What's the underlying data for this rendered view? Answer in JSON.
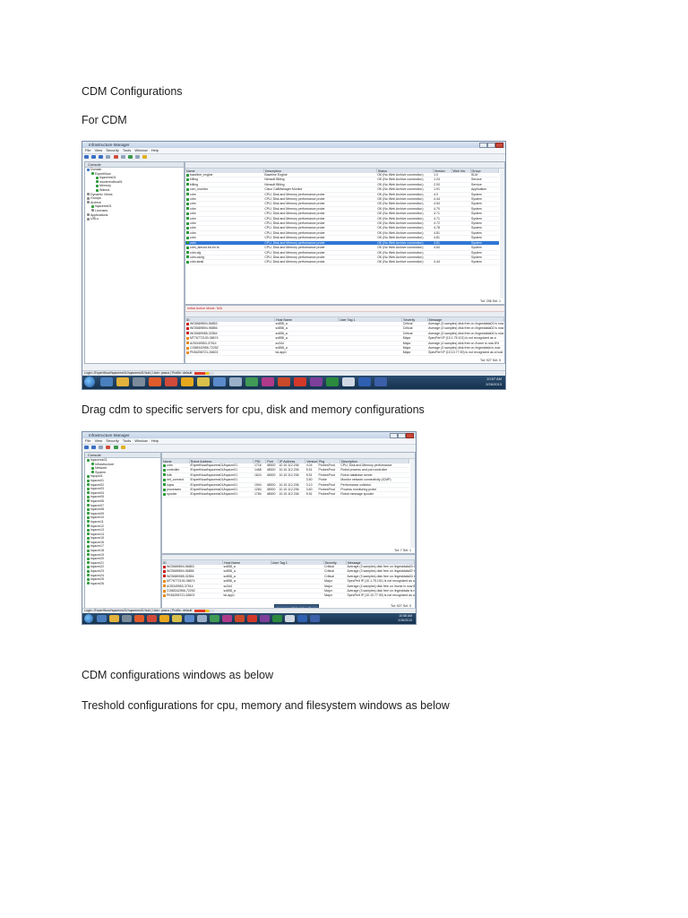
{
  "doc": {
    "heading1": "CDM Configurations",
    "heading2": "For CDM",
    "caption_drag": "Drag cdm to specific servers for cpu, disk and memory configurations",
    "caption_windows": "CDM configurations windows as below",
    "caption_threshold": "Treshold configurations for cpu, memory and filesystem windows as below"
  },
  "shot1": {
    "title": "Infrastructure Manager",
    "menu": [
      "File",
      "View",
      "Security",
      "Tools",
      "Window",
      "Help"
    ],
    "tree_header": "Console",
    "tree": [
      {
        "label": "Domain",
        "indent": 0,
        "color": "#3a74c8"
      },
      {
        "label": "ExpertNow",
        "indent": 1,
        "color": "#2e9a3a"
      },
      {
        "label": "hqacems01",
        "indent": 2,
        "color": "#2e9a3a"
      },
      {
        "label": "msoterrxdbxa01",
        "indent": 2,
        "color": "#2e9a3a"
      },
      {
        "label": "Memory",
        "indent": 2,
        "color": "#2e9a3a"
      },
      {
        "label": "Wanna",
        "indent": 2,
        "color": "#2e9a3a"
      },
      {
        "label": "Dynamic Views",
        "indent": 0,
        "color": "#8a8a8a"
      },
      {
        "label": "Groups",
        "indent": 0,
        "color": "#8a8a8a"
      },
      {
        "label": "Archive",
        "indent": 0,
        "color": "#8a8a8a"
      },
      {
        "label": "hqacems01",
        "indent": 1,
        "color": "#2e9a3a"
      },
      {
        "label": "Licenses",
        "indent": 1,
        "color": "#8a8a8a"
      },
      {
        "label": "Applications",
        "indent": 0,
        "color": "#8a8a8a"
      },
      {
        "label": "URLs",
        "indent": 0,
        "color": "#8a8a8a"
      }
    ],
    "probe_columns": [
      "Name",
      "Description",
      "Status",
      "Version",
      "Web Ver.",
      "Group"
    ],
    "probes": [
      {
        "name": "baseline_engine",
        "desc": "Baseline Engine",
        "status": "OK (No Web Archive connection)",
        "version": "1.0",
        "web": "",
        "group": "SLM"
      },
      {
        "name": "billing",
        "desc": "Nimsoft Billing",
        "status": "OK (No Web Archive connection)",
        "version": "1.24",
        "web": "",
        "group": "Service"
      },
      {
        "name": "billing",
        "desc": "Nimsoft Billing",
        "status": "OK (No Web Archive connection)",
        "version": "2.00",
        "web": "",
        "group": "Service"
      },
      {
        "name": "ccm_monitor",
        "desc": "Cisco CallManager Monitor",
        "status": "OK (No Web Archive connection)",
        "version": "1.91",
        "web": "",
        "group": "Application"
      },
      {
        "name": "cdm",
        "desc": "CPU, Disk and Memory performance probe",
        "status": "OK (No Web Archive connection)",
        "version": "4.0",
        "web": "",
        "group": "System"
      },
      {
        "name": "cdm",
        "desc": "CPU, Disk and Memory performance probe",
        "status": "OK (No Web Archive connection)",
        "version": "4.44",
        "web": "",
        "group": "System"
      },
      {
        "name": "cdm",
        "desc": "CPU, Disk and Memory performance probe",
        "status": "OK (No Web Archive connection)",
        "version": "4.54",
        "web": "",
        "group": "System"
      },
      {
        "name": "cdm",
        "desc": "CPU, Disk and Memory performance probe",
        "status": "OK (No Web Archive connection)",
        "version": "4.70",
        "web": "",
        "group": "System"
      },
      {
        "name": "cdm",
        "desc": "CPU, Disk and Memory performance probe",
        "status": "OK (No Web Archive connection)",
        "version": "4.71",
        "web": "",
        "group": "System"
      },
      {
        "name": "cdm",
        "desc": "CPU, Disk and Memory performance probe",
        "status": "OK (No Web Archive connection)",
        "version": "4.71",
        "web": "",
        "group": "System"
      },
      {
        "name": "cdm",
        "desc": "CPU, Disk and Memory performance probe",
        "status": "OK (No Web Archive connection)",
        "version": "4.72",
        "web": "",
        "group": "System"
      },
      {
        "name": "cdm",
        "desc": "CPU, Disk and Memory performance probe",
        "status": "OK (No Web Archive connection)",
        "version": "4.78",
        "web": "",
        "group": "System"
      },
      {
        "name": "cdm",
        "desc": "CPU, Disk and Memory performance probe",
        "status": "OK (No Web Archive connection)",
        "version": "4.81",
        "web": "",
        "group": "System"
      },
      {
        "name": "cdm",
        "desc": "CPU, Disk and Memory performance probe",
        "status": "OK (No Web Archive connection)",
        "version": "4.81",
        "web": "",
        "group": "System"
      },
      {
        "name": "cdm",
        "desc": "CPU, Disk and Memory performance probe",
        "status": "OK (No Web Archive connection)",
        "version": "4.81",
        "web": "",
        "group": "System"
      },
      {
        "name": "cdm_almost.trd.en.fo",
        "desc": "CPU, Disk and Memory performance probe",
        "status": "OK (No Web Archive connection)",
        "version": "4.84",
        "web": "",
        "group": "System"
      },
      {
        "name": "cdm.cfg",
        "desc": "CPU, Disk and Memory performance probe",
        "status": "OK (No Web Archive connection)",
        "version": "",
        "web": "",
        "group": "System"
      },
      {
        "name": "cdm.cdcfg",
        "desc": "CPU, Disk and Memory performance probe",
        "status": "OK (No Web Archive connection)",
        "version": "",
        "web": "",
        "group": "System"
      },
      {
        "name": "cdm.strait",
        "desc": "CPU, Disk and Memory performance probe",
        "status": "OK (No Web Archive connection)",
        "version": "4.44",
        "web": "",
        "group": "System"
      }
    ],
    "probe_total": "Tot: 296  Sel: 1",
    "alarm_title": "Initial Active Mode: N/A",
    "alarm_columns": [
      "ID",
      "Host Name",
      "User Tag 1",
      "Severity",
      "Message"
    ],
    "alarms": [
      {
        "id": "WO5689894-56853",
        "host": "sx858_a",
        "sev": "Critical",
        "msg": "Average (3 samples) disk free on /ingestdata03 is now"
      },
      {
        "id": "WO5689894-96856",
        "host": "sx858_a",
        "sev": "Critical",
        "msg": "Average (3 samples) disk free on /ingestdata02 is now"
      },
      {
        "id": "WO5689985-32554",
        "host": "sx858_a",
        "sev": "Critical",
        "msg": "Average (3 samples) disk free on /ingestdata04 is now"
      },
      {
        "id": "MT76772100-36674",
        "host": "sx858_a",
        "sev": "Major",
        "msg": "SpecPerf IP (10.1.75.101) is not recognized as a"
      },
      {
        "id": "AO5349553-37514",
        "host": "sx344",
        "sev": "Major",
        "msg": "Average (4 samples) disk free on /home is now 8%"
      },
      {
        "id": "CO88342556-72252",
        "host": "sx858_a",
        "sev": "Major",
        "msg": "Average (3 samples) disk free on /ingestdata is now"
      },
      {
        "id": "PK84256721-26603",
        "host": "tsl-app1",
        "sev": "Major",
        "msg": "SpecPerf IP (10.10.77.90) is not recognized as a host"
      }
    ],
    "alarm_total": "Tot: 927  Sel: 0",
    "statusbar": "Login: /ExpertNow/hqacems01/hqacems01/hub | User: pasus | Profile: default",
    "clock_time": "10:57 AM",
    "clock_date": "2/26/2013"
  },
  "shot2": {
    "title": "Infrastructure Manager",
    "menu": [
      "File",
      "View",
      "Security",
      "Tools",
      "Window",
      "Help"
    ],
    "tree_header": "Console",
    "tree": [
      {
        "label": "hqacems01",
        "indent": 0,
        "color": "#2e9a3a"
      },
      {
        "label": "Infrastructure",
        "indent": 1,
        "color": "#2e9a3a"
      },
      {
        "label": "Network",
        "indent": 1,
        "color": "#2e9a3a"
      },
      {
        "label": "System",
        "indent": 1,
        "color": "#2e9a3a"
      },
      {
        "label": "hqcpo01",
        "indent": 0,
        "color": "#2e9a3a"
      },
      {
        "label": "hqacrn01",
        "indent": 0,
        "color": "#2e9a3a"
      },
      {
        "label": "hqacrn02",
        "indent": 0,
        "color": "#2e9a3a"
      },
      {
        "label": "hqacrn03",
        "indent": 0,
        "color": "#2e9a3a"
      },
      {
        "label": "hqacrn04",
        "indent": 0,
        "color": "#2e9a3a"
      },
      {
        "label": "hqacrn05",
        "indent": 0,
        "color": "#2e9a3a"
      },
      {
        "label": "hqacrn06",
        "indent": 0,
        "color": "#2e9a3a"
      },
      {
        "label": "hqacrn07",
        "indent": 0,
        "color": "#2e9a3a"
      },
      {
        "label": "hqacrn08",
        "indent": 0,
        "color": "#2e9a3a"
      },
      {
        "label": "hqacrn09",
        "indent": 0,
        "color": "#2e9a3a"
      },
      {
        "label": "hqacrn10",
        "indent": 0,
        "color": "#2e9a3a"
      },
      {
        "label": "hqacrn11",
        "indent": 0,
        "color": "#2e9a3a"
      },
      {
        "label": "hqacrn12",
        "indent": 0,
        "color": "#2e9a3a"
      },
      {
        "label": "hqacrn13",
        "indent": 0,
        "color": "#2e9a3a"
      },
      {
        "label": "hqacrn14",
        "indent": 0,
        "color": "#2e9a3a"
      },
      {
        "label": "hqacrn15",
        "indent": 0,
        "color": "#2e9a3a"
      },
      {
        "label": "hqacrn16",
        "indent": 0,
        "color": "#2e9a3a"
      },
      {
        "label": "hqacrn17",
        "indent": 0,
        "color": "#2e9a3a"
      },
      {
        "label": "hqacrn18",
        "indent": 0,
        "color": "#2e9a3a"
      },
      {
        "label": "hqacrn19",
        "indent": 0,
        "color": "#2e9a3a"
      },
      {
        "label": "hqacrn20",
        "indent": 0,
        "color": "#2e9a3a"
      },
      {
        "label": "hqacrn21",
        "indent": 0,
        "color": "#2e9a3a"
      },
      {
        "label": "hqacrn22",
        "indent": 0,
        "color": "#2e9a3a"
      },
      {
        "label": "hqacrn23",
        "indent": 0,
        "color": "#2e9a3a"
      },
      {
        "label": "hqacrn24",
        "indent": 0,
        "color": "#2e9a3a"
      },
      {
        "label": "hqacrn25",
        "indent": 0,
        "color": "#2e9a3a"
      },
      {
        "label": "hqacrn26",
        "indent": 0,
        "color": "#2e9a3a"
      }
    ],
    "probe_columns": [
      "Name",
      "Robot Address",
      "PID",
      "Port",
      "IP Address",
      "Version",
      "Pkg",
      "Description"
    ],
    "probes": [
      {
        "name": "cdm",
        "addr": "/ExpertNow/hqacems01/hqacrn01",
        "pid": "1716",
        "port": "48000",
        "ip": "10.10.112.206",
        "ver": "4.04",
        "pkg": "ProbesProd",
        "desc": "CPU, Disk and Memory performance"
      },
      {
        "name": "controller",
        "addr": "/ExpertNow/hqacems01/hqacrn01",
        "pid": "1468",
        "port": "48000",
        "ip": "10.10.112.206",
        "ver": "5.51",
        "pkg": "ProbesProd",
        "desc": "Robot process and port controller"
      },
      {
        "name": "hdb",
        "addr": "/ExpertNow/hqacems01/hqacrn01",
        "pid": "1624",
        "port": "48000",
        "ip": "10.10.112.206",
        "ver": "5.51",
        "pkg": "ProbesProd",
        "desc": "Robot database server"
      },
      {
        "name": "net_connect",
        "addr": "/ExpertNow/hqacems01/hqacrn01",
        "pid": "",
        "port": "",
        "ip": "",
        "ver": "3.50",
        "pkg": "Probe",
        "desc": "Monitor network connectivity (ICMP)"
      },
      {
        "name": "nqsw",
        "addr": "/ExpertNow/hqacems01/hqacrn01",
        "pid": "1904",
        "port": "48000",
        "ip": "10.10.112.206",
        "ver": "3.10",
        "pkg": "ProbesProd",
        "desc": "Performance collector"
      },
      {
        "name": "processes",
        "addr": "/ExpertNow/hqacems01/hqacrn01",
        "pid": "1284",
        "port": "48000",
        "ip": "10.10.112.206",
        "ver": "3.60",
        "pkg": "ProbesProd",
        "desc": "Process monitoring probe"
      },
      {
        "name": "spooler",
        "addr": "/ExpertNow/hqacems01/hqacrn01",
        "pid": "1784",
        "port": "48000",
        "ip": "10.10.112.206",
        "ver": "5.51",
        "pkg": "ProbesProd",
        "desc": "Robot message spooler"
      }
    ],
    "probe_total": "Tot: 7  Sel: 1",
    "alarm_columns": [
      "ID",
      "Host Name",
      "User Tag 1",
      "Severity",
      "Message"
    ],
    "alarms": [
      {
        "id": "WO5689894-56853",
        "host": "sx858_a",
        "sev": "Critical",
        "msg": "Average (3 samples) disk free on /ingestdata03 is now"
      },
      {
        "id": "WO5689894-96856",
        "host": "sx858_a",
        "sev": "Critical",
        "msg": "Average (3 samples) disk free on /ingestdata02 is now"
      },
      {
        "id": "WO5689985-32554",
        "host": "sx858_a",
        "sev": "Critical",
        "msg": "Average (3 samples) disk free on /ingestdata04 is now"
      },
      {
        "id": "MT76772100-36674",
        "host": "sx858_a",
        "sev": "Major",
        "msg": "SpecPerf IP (10.1.75.101) is not recognized as a"
      },
      {
        "id": "AO5349553-37514",
        "host": "sx344",
        "sev": "Major",
        "msg": "Average (4 samples) disk free on /home is now 8%"
      },
      {
        "id": "CO88342556-72252",
        "host": "sx858_a",
        "sev": "Major",
        "msg": "Average (3 samples) disk free on /ingestdata is now"
      },
      {
        "id": "PK84256721-26603",
        "host": "tsl-app1",
        "sev": "Major",
        "msg": "SpecPerf IP (10.10.77.90) is not recognized as a host"
      }
    ],
    "alarm_total": "Tot: 927  Sel: 0",
    "popup": "hqacems01/hub/ls - Sent",
    "statusbar": "Login: /ExpertNow/hqacems01/hqacems01/hub | User: pasus | Profile: default",
    "clock_time": "10:58 AM",
    "clock_date": "2/26/2013"
  }
}
